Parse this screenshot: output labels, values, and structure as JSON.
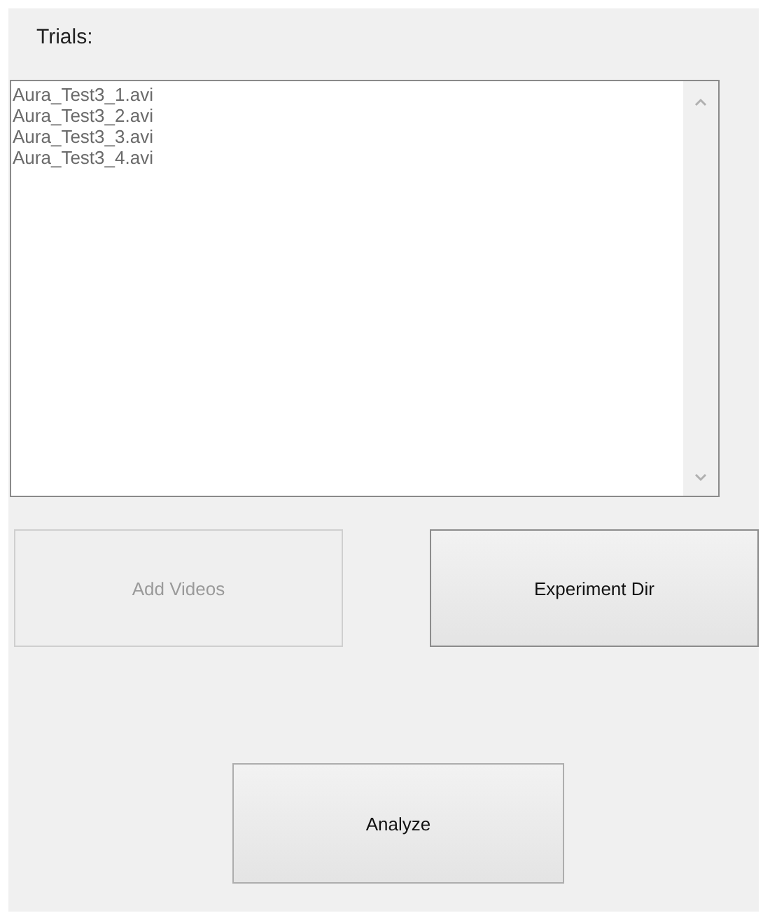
{
  "label": "Trials:",
  "trials": [
    "Aura_Test3_1.avi",
    "Aura_Test3_2.avi",
    "Aura_Test3_3.avi",
    "Aura_Test3_4.avi"
  ],
  "buttons": [
    {
      "label": "Add Videos",
      "disabled": true
    },
    {
      "label": "Experiment Dir",
      "disabled": false
    }
  ],
  "analyze": {
    "label": "Analyze",
    "disabled": false
  }
}
